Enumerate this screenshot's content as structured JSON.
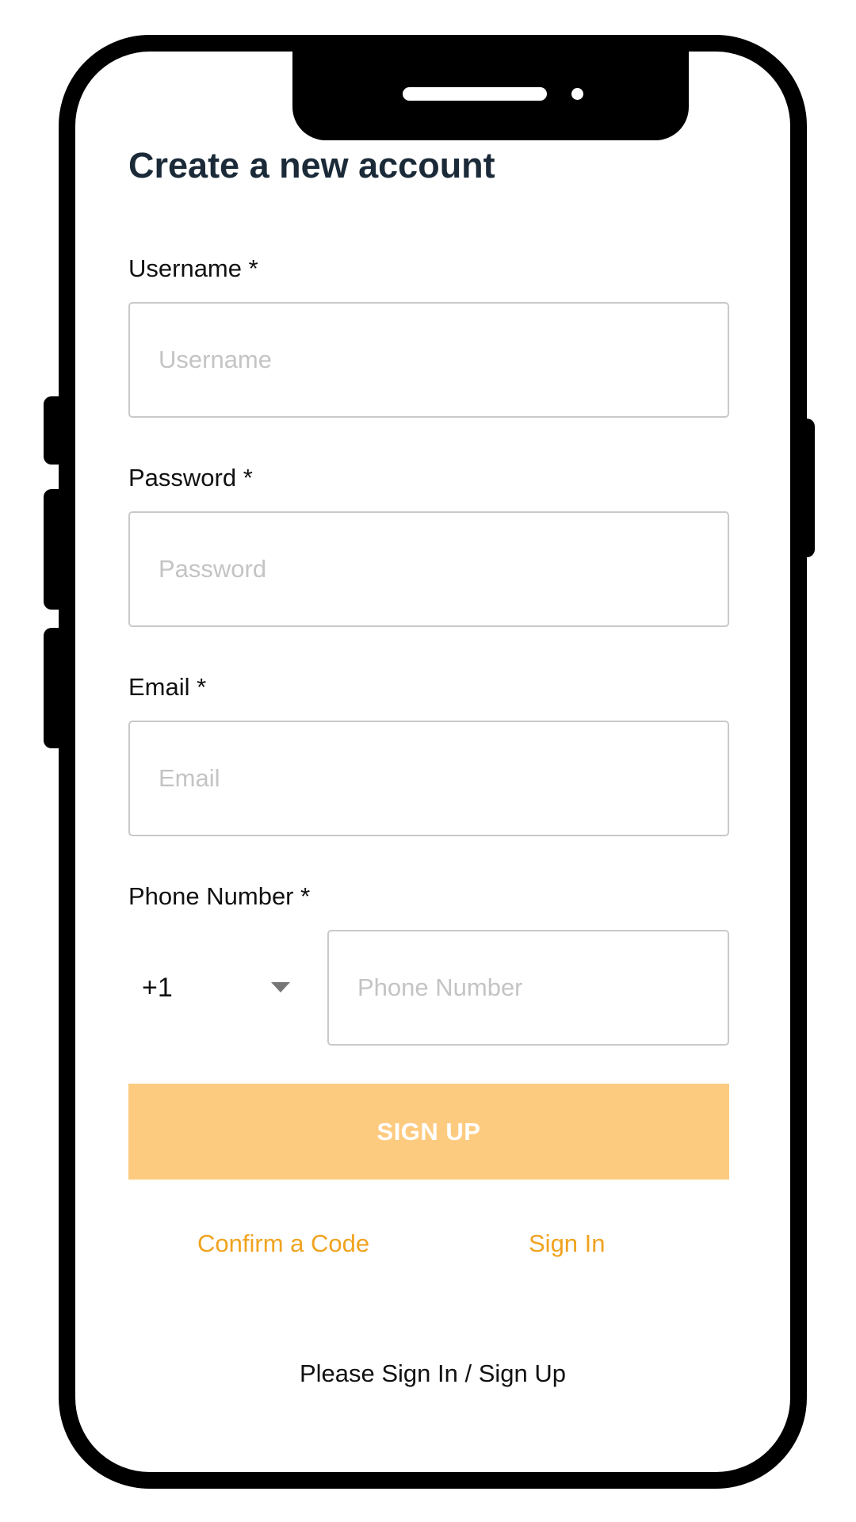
{
  "form": {
    "title": "Create a new account",
    "username": {
      "label": "Username *",
      "placeholder": "Username",
      "value": ""
    },
    "password": {
      "label": "Password *",
      "placeholder": "Password",
      "value": ""
    },
    "email": {
      "label": "Email *",
      "placeholder": "Email",
      "value": ""
    },
    "phone": {
      "label": "Phone Number *",
      "country_code": "+1",
      "placeholder": "Phone Number",
      "value": ""
    },
    "submit_label": "SIGN UP"
  },
  "links": {
    "confirm_code": "Confirm a Code",
    "sign_in": "Sign In"
  },
  "footer": {
    "text": "Please Sign In / Sign Up"
  },
  "colors": {
    "title": "#1b2a38",
    "accent": "#f0a31f",
    "button_bg": "#fdcb80",
    "button_text": "#ffffff",
    "field_border": "#c9c9c9",
    "placeholder": "#c4c4c4",
    "device_frame": "#000000"
  },
  "icons": {
    "country_dropdown": "caret-down-icon"
  }
}
